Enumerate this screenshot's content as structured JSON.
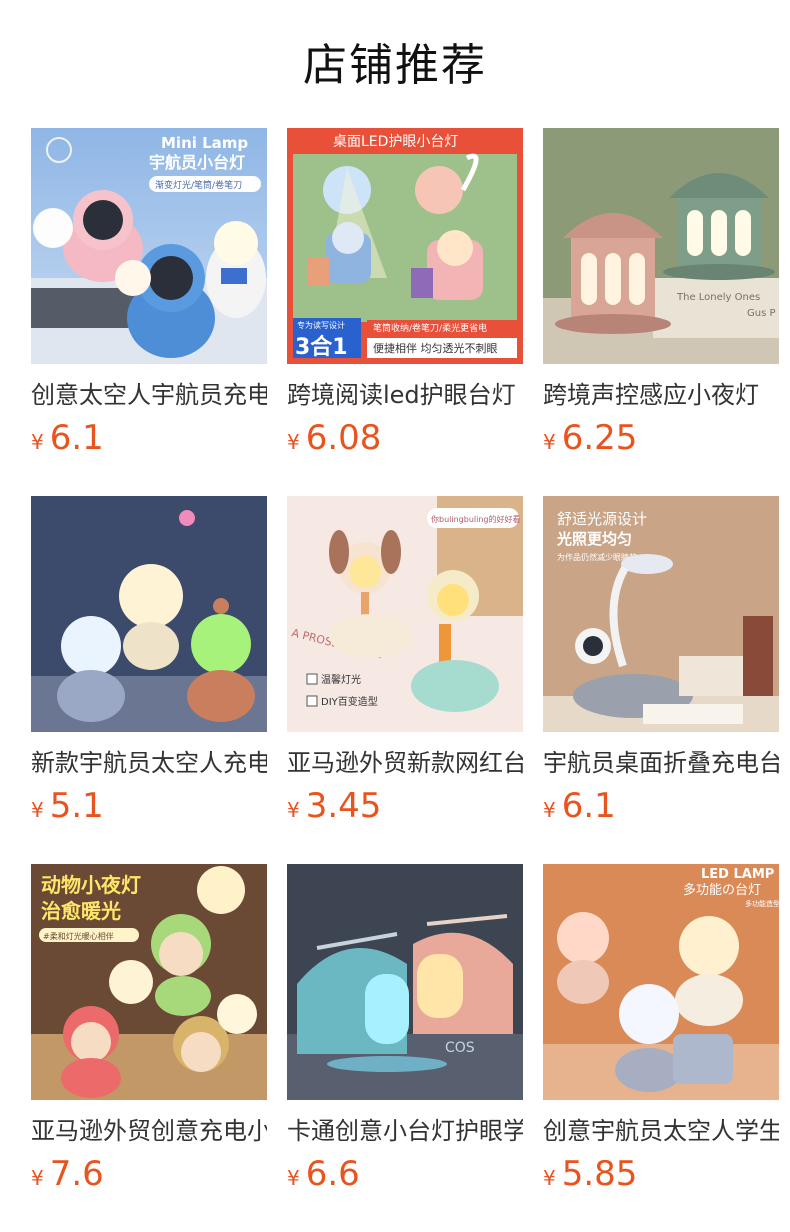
{
  "page": {
    "title": "店铺推荐"
  },
  "currency": "¥",
  "products": [
    {
      "name": "创意太空人宇航员充电",
      "price": "6.1",
      "image_text": {
        "line1": "Mini Lamp",
        "line2": "宇航员小台灯",
        "line3": "渐变灯光/笔筒/卷笔刀"
      }
    },
    {
      "name": "跨境阅读led护眼台灯",
      "price": "6.08",
      "image_text": {
        "banner": "桌面LED护眼小台灯",
        "tag": "专为读写设计",
        "big": "3合1",
        "line1": "笔筒收纳/卷笔刀/柔光更省电",
        "line2": "便捷相伴 均匀透光不刺眼"
      }
    },
    {
      "name": "跨境声控感应小夜灯",
      "price": "6.25",
      "image_text": {
        "line1": "The Lonely Ones",
        "line2": "Gus P"
      }
    },
    {
      "name": "新款宇航员太空人充电",
      "price": "5.1",
      "image_text": {}
    },
    {
      "name": "亚马逊外贸新款网红台灯",
      "price": "3.45",
      "image_text": {
        "tag": "你bulingbuling的好好看",
        "line1": "温馨灯光",
        "line2": "DIY百变造型",
        "bg": "A PROSE MONDE"
      }
    },
    {
      "name": "宇航员桌面折叠充电台灯",
      "price": "6.1",
      "image_text": {
        "line1": "舒适光源设计",
        "line2": "光照更均匀",
        "line3": "为作品仍然减少眼睛劳"
      }
    },
    {
      "name": "亚马逊外贸创意充电小夜灯",
      "price": "7.6",
      "image_text": {
        "line1": "动物小夜灯",
        "line2": "治愈暖光",
        "line3": "#柔和灯光暖心相伴"
      }
    },
    {
      "name": "卡通创意小台灯护眼学习",
      "price": "6.6",
      "image_text": {
        "line1": "COS"
      }
    },
    {
      "name": "创意宇航员太空人学生台灯",
      "price": "5.85",
      "image_text": {
        "line1": "LED LAMP",
        "line2": "多功能の台灯",
        "line3": "多功能造型"
      }
    }
  ]
}
